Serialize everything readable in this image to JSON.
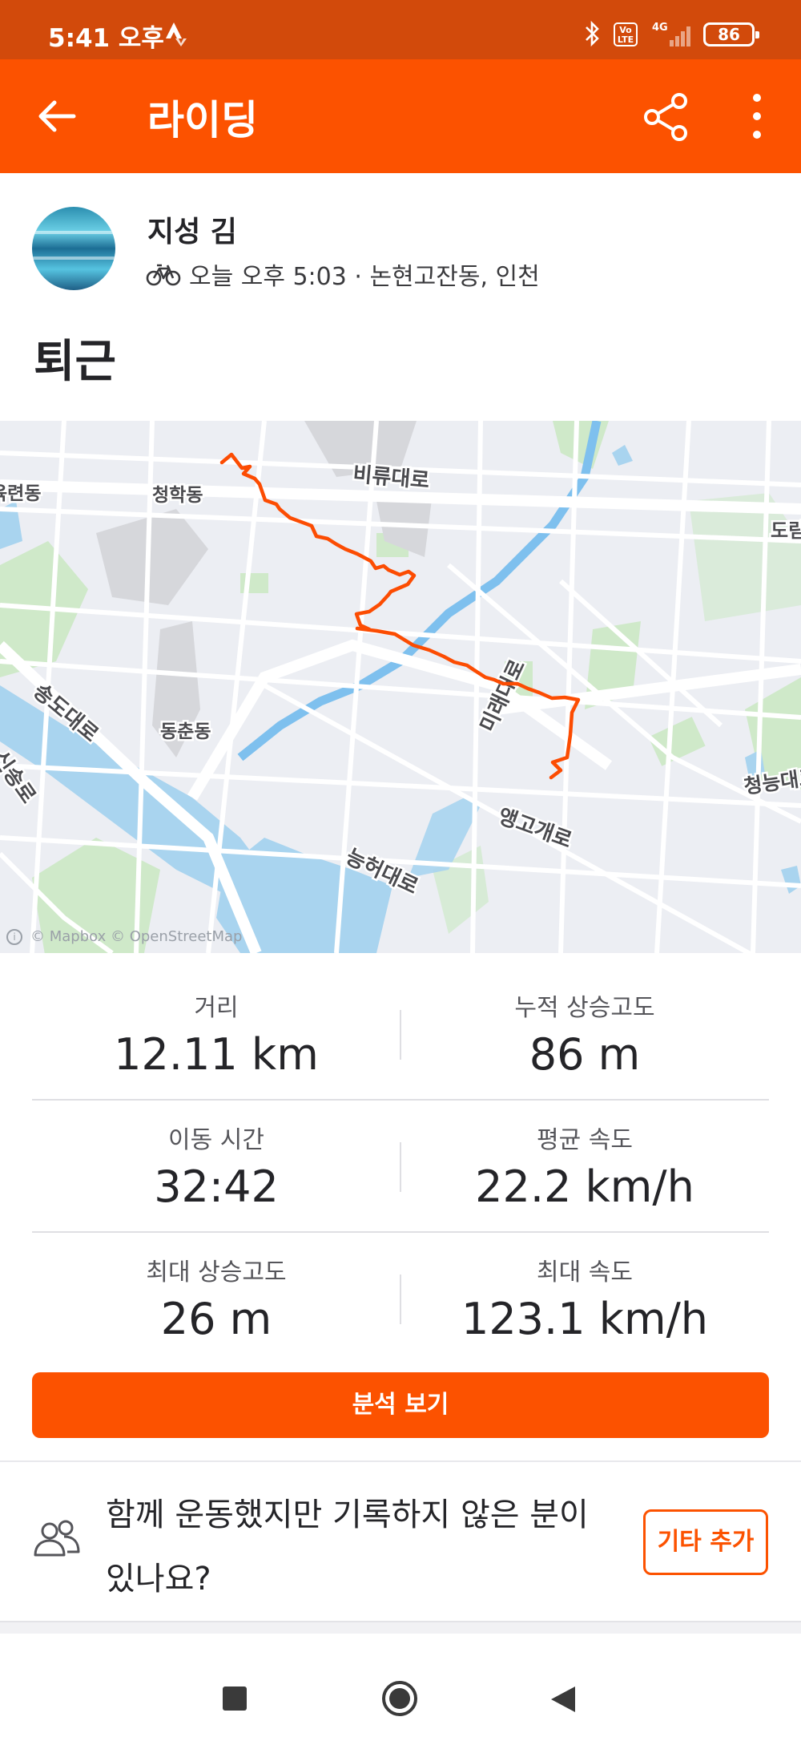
{
  "status_bar": {
    "time": "5:41 오후",
    "volte": "Vo LTE",
    "network": "4G",
    "battery": "86"
  },
  "app_bar": {
    "title": "라이딩"
  },
  "activity": {
    "athlete_name": "지성 김",
    "meta": "오늘 오후 5:03 · 논현고잔동, 인천",
    "title": "퇴근"
  },
  "map": {
    "labels": {
      "yukryeon": "육련동",
      "cheonghak": "청학동",
      "biryu": "비류대로",
      "dorim": "도림",
      "dongchun": "동춘동",
      "songdo": "송도대로",
      "sinsong": "신송로",
      "mi": "미래대로",
      "cheongneung": "청능대로",
      "aenggo": "앵고개로",
      "neungheo": "능허대로"
    },
    "attribution": "© Mapbox © OpenStreetMap",
    "route_color": "#fc4c02"
  },
  "stats": [
    {
      "left": {
        "label": "거리",
        "value": "12.11 km"
      },
      "right": {
        "label": "누적 상승고도",
        "value": "86 m"
      }
    },
    {
      "left": {
        "label": "이동 시간",
        "value": "32:42"
      },
      "right": {
        "label": "평균 속도",
        "value": "22.2 km/h"
      }
    },
    {
      "left": {
        "label": "최대 상승고도",
        "value": "26 m"
      },
      "right": {
        "label": "최대 속도",
        "value": "123.1 km/h"
      }
    }
  ],
  "actions": {
    "analyze": "분석 보기",
    "prompt": "함께 운동했지만 기록하지 않은 분이 있나요?",
    "add_other": "기타 추가"
  },
  "colors": {
    "brand": "#fc5200",
    "status_bar": "#d24a0b"
  }
}
